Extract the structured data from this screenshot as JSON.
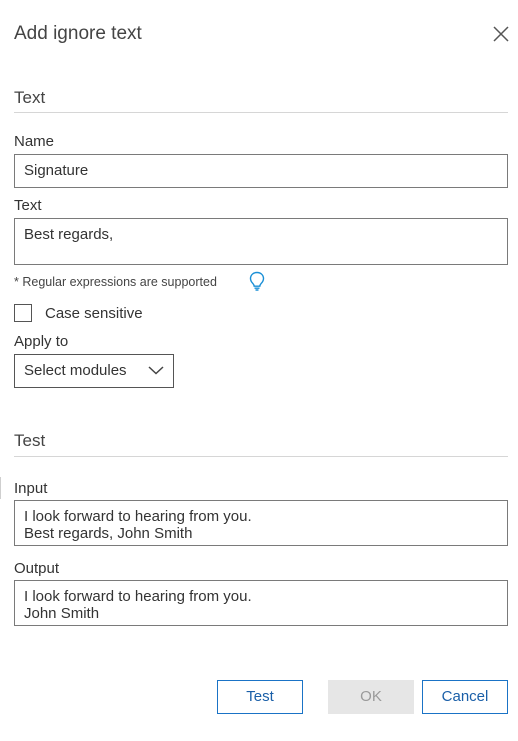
{
  "dialog": {
    "title": "Add ignore text",
    "close_icon": "close-icon"
  },
  "text_section": {
    "heading": "Text",
    "name_label": "Name",
    "name_value": "Signature",
    "text_label": "Text",
    "text_value": "Best regards,",
    "regex_note": "* Regular expressions are supported",
    "hint_icon": "lightbulb-icon",
    "case_sensitive_label": "Case sensitive",
    "case_sensitive_checked": false,
    "apply_to_label": "Apply to",
    "apply_to_value": "Select modules",
    "apply_to_icon": "chevron-down-icon"
  },
  "test_section": {
    "heading": "Test",
    "input_label": "Input",
    "input_value": "I look forward to hearing from you.\nBest regards, John Smith",
    "output_label": "Output",
    "output_value": "I look forward to hearing from you.\nJohn Smith"
  },
  "buttons": {
    "test": "Test",
    "ok": "OK",
    "cancel": "Cancel"
  },
  "colors": {
    "accent": "#1a73c6",
    "hint_icon": "#1a8fd6",
    "disabled_bg": "#e6e6e6"
  }
}
